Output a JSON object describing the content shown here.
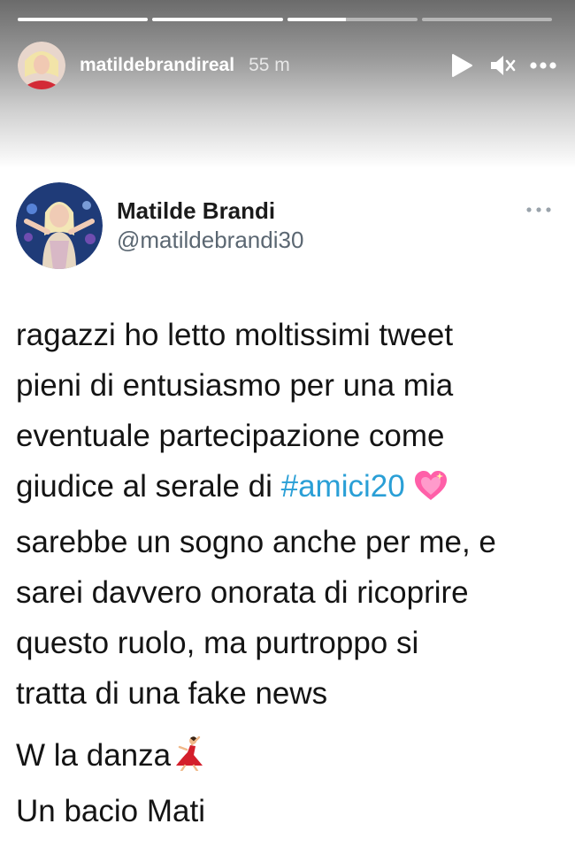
{
  "story": {
    "username": "matildebrandireal",
    "time_ago": "55 m",
    "progress": [
      1.0,
      1.0,
      0.45,
      0.0
    ],
    "controls": {
      "play_icon": "play-icon",
      "mute_icon": "muted-speaker-icon",
      "more_icon": "more-horizontal-icon"
    }
  },
  "tweet": {
    "author_name": "Matilde Brandi",
    "author_handle": "@matildebrandi30",
    "text_lines": [
      "ragazzi ho letto moltissimi tweet",
      "pieni di entusiasmo per una mia",
      "eventuale partecipazione come",
      "giudice al serale di ",
      "sarebbe un sogno anche per me, e",
      "sarei davvero onorata di ricoprire",
      "questo ruolo, ma purtroppo si",
      "tratta di una fake news"
    ],
    "hashtag": "#amici20",
    "signoff_line1": "W la danza",
    "signoff_line2": "Un bacio Mati",
    "emoji_heart": "pink-sparkling-heart-icon",
    "emoji_dancer": "dancer-icon"
  },
  "colors": {
    "hashtag": "#2a9fd6",
    "text": "#141414",
    "handle": "#5b6772",
    "heart": "#ff5fa8",
    "dancer_dress": "#d41f2b"
  }
}
